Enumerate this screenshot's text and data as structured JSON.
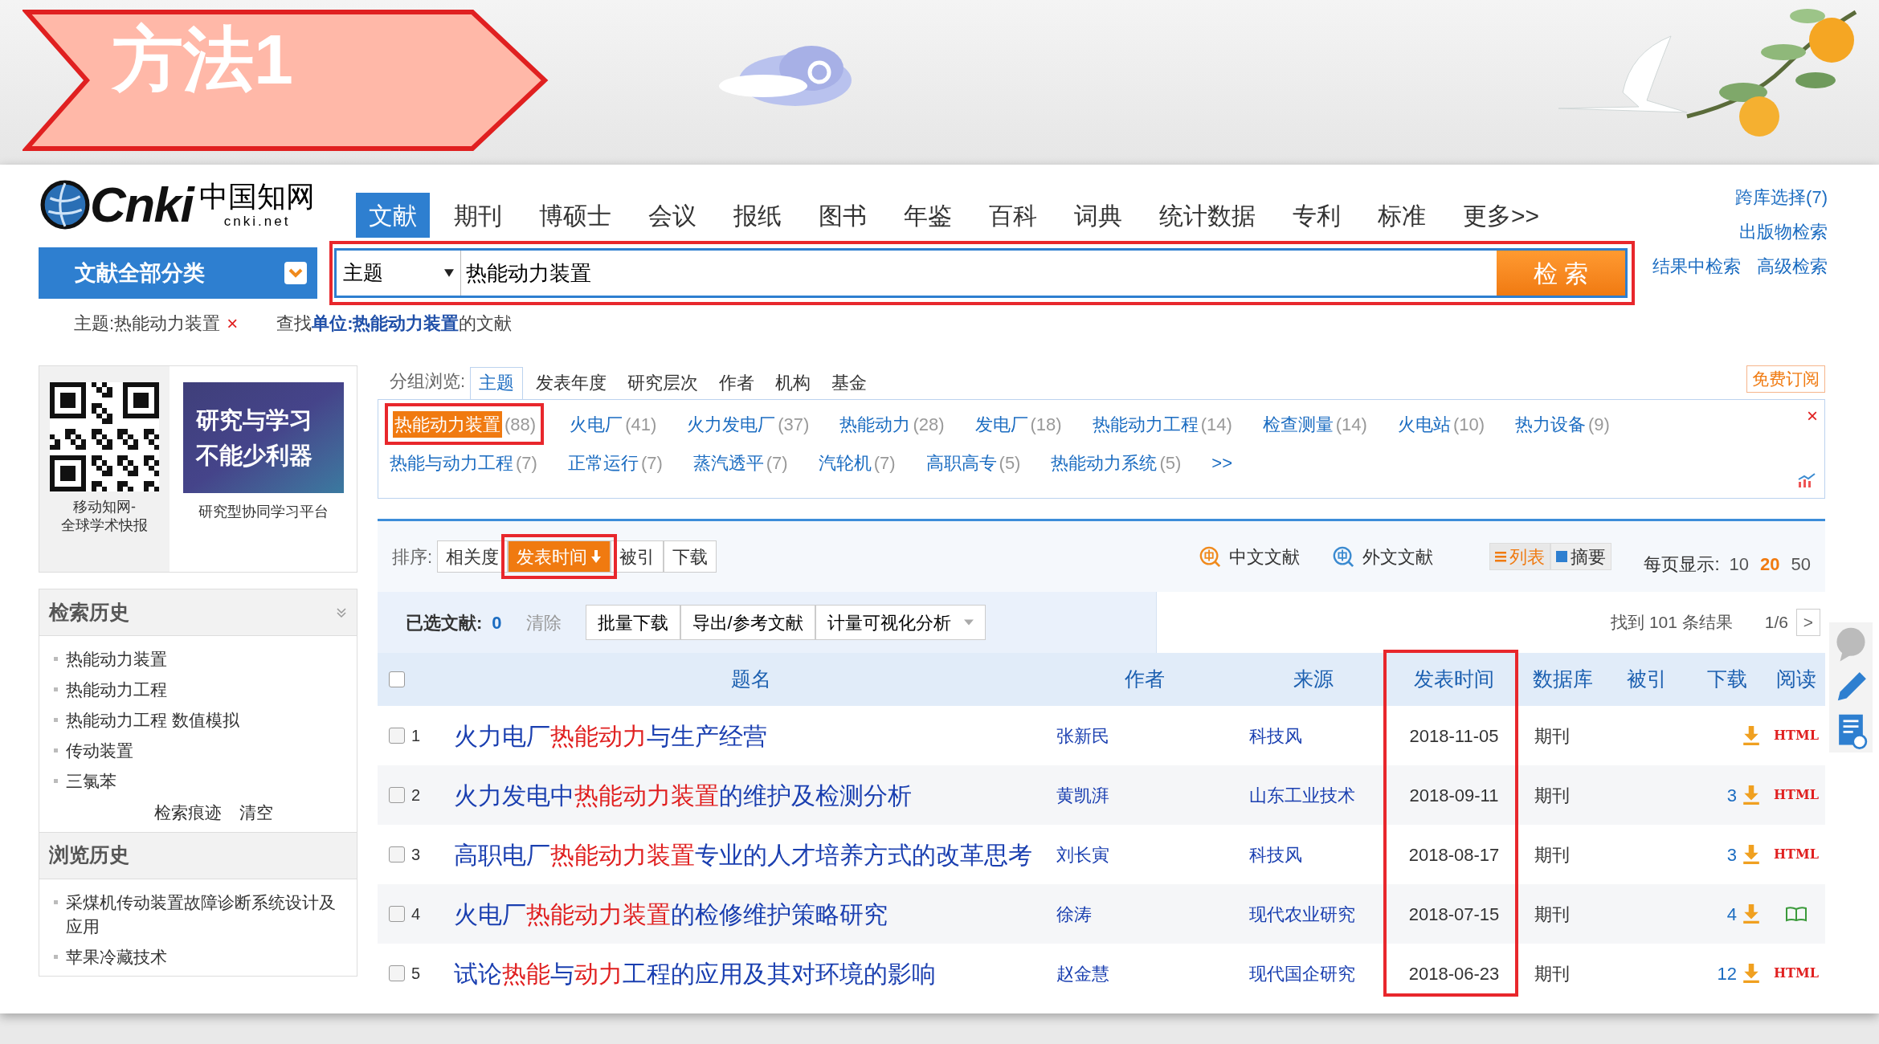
{
  "banner": {
    "title": "方法1"
  },
  "header": {
    "logo": {
      "wordmark": "Cnki",
      "chinese": "中国知网",
      "domain": "cnki.net"
    },
    "tabs": [
      {
        "label": "文献",
        "selected": true
      },
      {
        "label": "期刊",
        "selected": false
      },
      {
        "label": "博硕士",
        "selected": false
      },
      {
        "label": "会议",
        "selected": false
      },
      {
        "label": "报纸",
        "selected": false
      },
      {
        "label": "图书",
        "selected": false
      },
      {
        "label": "年鉴",
        "selected": false
      },
      {
        "label": "百科",
        "selected": false
      },
      {
        "label": "词典",
        "selected": false
      },
      {
        "label": "统计数据",
        "selected": false
      },
      {
        "label": "专利",
        "selected": false
      },
      {
        "label": "标准",
        "selected": false
      },
      {
        "label": "更多>>",
        "selected": false
      }
    ],
    "links": [
      "跨库选择(7)",
      "出版物检索",
      "结果中检索",
      "高级检索"
    ]
  },
  "search": {
    "category_button": "文献全部分类",
    "field": "主题",
    "value": "热能动力装置",
    "button": "检 索"
  },
  "breadcrumb": {
    "term": "主题:热能动力装置",
    "remove": "×",
    "hint": "查找**单位:热能动力装置**的文献"
  },
  "sidebar": {
    "qr_caption": [
      "移动知网-",
      "全球学术快报"
    ],
    "promo_lines": [
      "研究与学习",
      "不能少利器"
    ],
    "promo_caption": "研究型协同学习平台",
    "search_history": {
      "title": "检索历史",
      "items": [
        "热能动力装置",
        "热能动力工程",
        "热能动力工程 数值模拟",
        "传动装置",
        "三氯苯"
      ],
      "links": [
        "检索痕迹",
        "清空"
      ]
    },
    "browse_history": {
      "title": "浏览历史",
      "items": [
        "采煤机传动装置故障诊断系统设计及应用",
        "苹果冷藏技术"
      ]
    }
  },
  "group_browse": {
    "label": "分组浏览:",
    "tabs": [
      {
        "label": "主题",
        "selected": true
      },
      {
        "label": "发表年度",
        "selected": false
      },
      {
        "label": "研究层次",
        "selected": false
      },
      {
        "label": "作者",
        "selected": false
      },
      {
        "label": "机构",
        "selected": false
      },
      {
        "label": "基金",
        "selected": false
      }
    ],
    "subscribe": "免费订阅",
    "topics": [
      {
        "label": "热能动力装置",
        "count": "(88)",
        "selected": true
      },
      {
        "label": "火电厂",
        "count": "(41)",
        "selected": false
      },
      {
        "label": "火力发电厂",
        "count": "(37)",
        "selected": false
      },
      {
        "label": "热能动力",
        "count": "(28)",
        "selected": false
      },
      {
        "label": "发电厂",
        "count": "(18)",
        "selected": false
      },
      {
        "label": "热能动力工程",
        "count": "(14)",
        "selected": false
      },
      {
        "label": "检查测量",
        "count": "(14)",
        "selected": false
      },
      {
        "label": "火电站",
        "count": "(10)",
        "selected": false
      },
      {
        "label": "热力设备",
        "count": "(9)",
        "selected": false
      },
      {
        "label": "热能与动力工程",
        "count": "(7)",
        "selected": false
      },
      {
        "label": "正常运行",
        "count": "(7)",
        "selected": false
      },
      {
        "label": "蒸汽透平",
        "count": "(7)",
        "selected": false
      },
      {
        "label": "汽轮机",
        "count": "(7)",
        "selected": false
      },
      {
        "label": "高职高专",
        "count": "(5)",
        "selected": false
      },
      {
        "label": "热能动力系统",
        "count": "(5)",
        "selected": false
      }
    ],
    "more": ">>",
    "close": "×"
  },
  "sort": {
    "label": "排序:",
    "options": [
      {
        "label": "相关度",
        "selected": false
      },
      {
        "label": "发表时间",
        "selected": true
      },
      {
        "label": "被引",
        "selected": false
      },
      {
        "label": "下载",
        "selected": false
      }
    ],
    "language": [
      "中文文献",
      "外文文献"
    ],
    "views": [
      {
        "label": "列表",
        "selected": true
      },
      {
        "label": "摘要",
        "selected": false
      }
    ],
    "per_page_label": "每页显示:",
    "per_page": [
      {
        "label": "10",
        "selected": false
      },
      {
        "label": "20",
        "selected": true
      },
      {
        "label": "50",
        "selected": false
      }
    ]
  },
  "selection": {
    "label": "已选文献:",
    "count": "0",
    "clear": "清除",
    "buttons": [
      "批量下载",
      "导出/参考文献",
      "计量可视化分析"
    ],
    "result": "找到 101 条结果",
    "pager": "1/6",
    "next": ">"
  },
  "table": {
    "columns": [
      "题名",
      "作者",
      "来源",
      "发表时间",
      "数据库",
      "被引",
      "下载",
      "阅读"
    ],
    "header_checked": false,
    "rows": [
      {
        "checked": false,
        "index": "1",
        "title": [
          {
            "text": "火力电厂",
            "highlight": false
          },
          {
            "text": "热能动力",
            "highlight": true
          },
          {
            "text": "与生产经营",
            "highlight": false
          }
        ],
        "author": "张新民",
        "source": "科技风",
        "date": "2018-11-05",
        "database": "期刊",
        "read": "HTML"
      },
      {
        "checked": false,
        "index": "2",
        "title": [
          {
            "text": "火力发电中",
            "highlight": false
          },
          {
            "text": "热能动力装置",
            "highlight": true
          },
          {
            "text": "的维护及检测分析",
            "highlight": false
          }
        ],
        "author": "黄凯湃",
        "source": "山东工业技术",
        "date": "2018-09-11",
        "database": "期刊",
        "downloads": "3",
        "read": "HTML"
      },
      {
        "checked": false,
        "index": "3",
        "title": [
          {
            "text": "高职电厂",
            "highlight": false
          },
          {
            "text": "热能动力装置",
            "highlight": true
          },
          {
            "text": "专业的人才培养方式的改革思考",
            "highlight": false
          }
        ],
        "author": "刘长寅",
        "source": "科技风",
        "date": "2018-08-17",
        "database": "期刊",
        "downloads": "3",
        "read": "HTML"
      },
      {
        "checked": false,
        "index": "4",
        "title": [
          {
            "text": "火电厂",
            "highlight": false
          },
          {
            "text": "热能动力装置",
            "highlight": true
          },
          {
            "text": "的检修维护策略研究",
            "highlight": false
          }
        ],
        "author": "徐涛",
        "source": "现代农业研究",
        "date": "2018-07-15",
        "database": "期刊",
        "downloads": "4"
      },
      {
        "checked": false,
        "index": "5",
        "title": [
          {
            "text": "试论",
            "highlight": false
          },
          {
            "text": "热能",
            "highlight": true
          },
          {
            "text": "与",
            "highlight": false
          },
          {
            "text": "动力",
            "highlight": true
          },
          {
            "text": "工程的应用及其对环境的影响",
            "highlight": false
          }
        ],
        "author": "赵金慧",
        "source": "现代国企研究",
        "date": "2018-06-23",
        "database": "期刊",
        "downloads": "12",
        "read": "HTML"
      }
    ]
  }
}
